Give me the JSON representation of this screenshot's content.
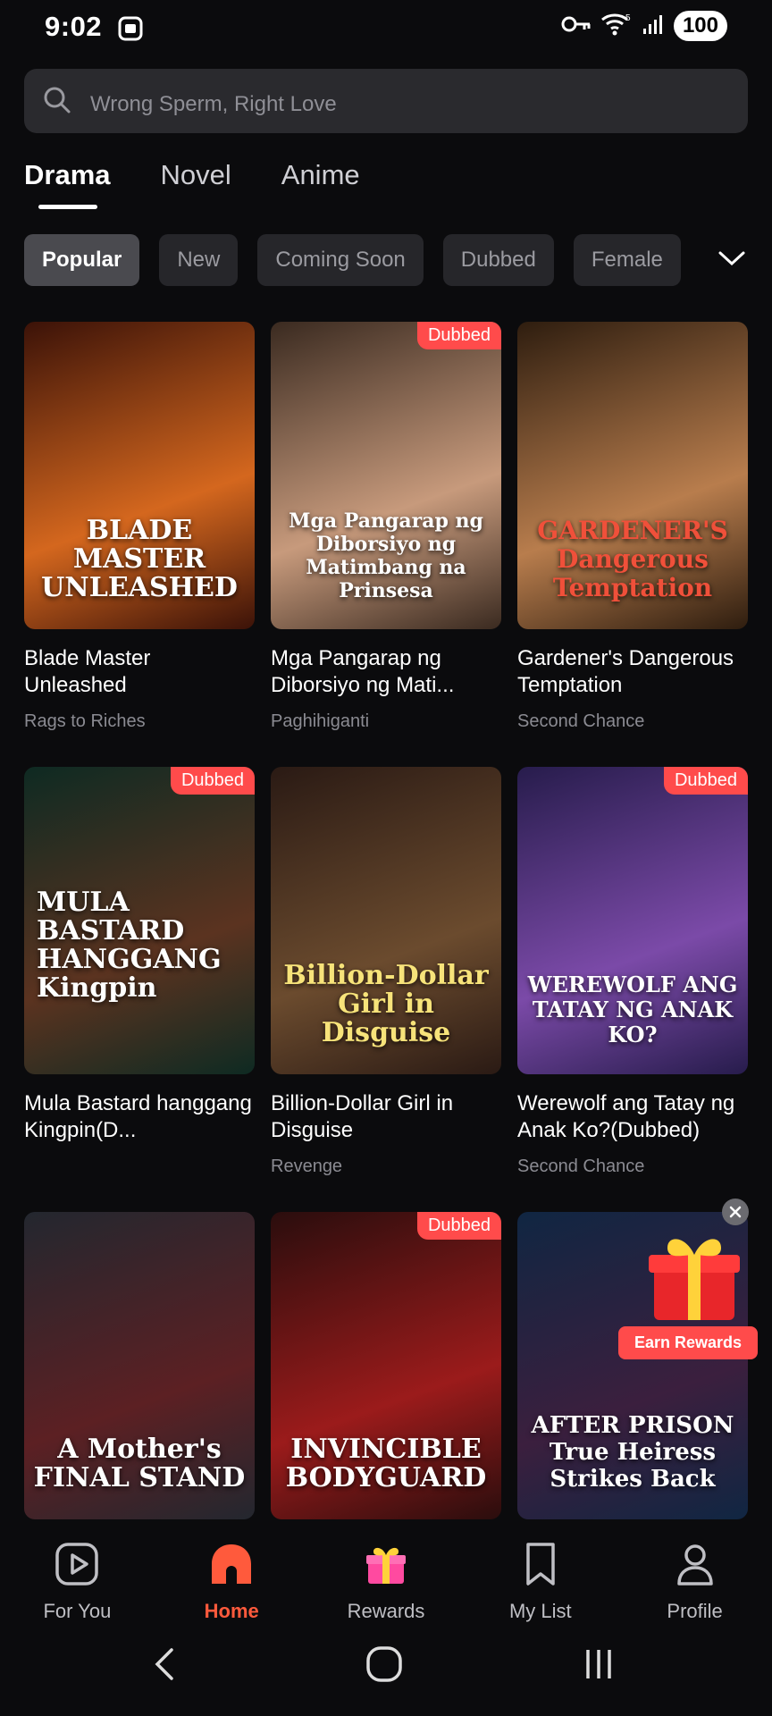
{
  "status": {
    "time": "9:02",
    "battery": "100",
    "signal": "5"
  },
  "search": {
    "placeholder": "Wrong Sperm, Right Love"
  },
  "tabs": [
    {
      "label": "Drama",
      "active": true
    },
    {
      "label": "Novel",
      "active": false
    },
    {
      "label": "Anime",
      "active": false
    }
  ],
  "filters": [
    {
      "label": "Popular",
      "active": true
    },
    {
      "label": "New"
    },
    {
      "label": "Coming Soon"
    },
    {
      "label": "Dubbed"
    },
    {
      "label": "Female"
    }
  ],
  "cards": [
    {
      "title": "Blade Master Unleashed",
      "genre": "Rags to Riches",
      "badge": "",
      "poster_text": "BLADE MASTER UNLEASHED",
      "colors": [
        "#3b1208",
        "#d4671e"
      ]
    },
    {
      "title": "Mga Pangarap ng Diborsiyo ng Mati...",
      "genre": "Paghihiganti",
      "badge": "Dubbed",
      "poster_text": "Mga Pangarap ng Diborsiyo ng Matimbang na Prinsesa",
      "colors": [
        "#3a2a20",
        "#c79a7c"
      ]
    },
    {
      "title": "Gardener's Dangerous Temptation",
      "genre": "Second Chance",
      "badge": "",
      "poster_text": "GARDENER'S Dangerous Temptation",
      "colors": [
        "#2e1d0f",
        "#b87d4d"
      ]
    },
    {
      "title": "Mula Bastard hanggang Kingpin(D...",
      "genre": "",
      "badge": "Dubbed",
      "poster_text": "MULA BASTARD HANGGANG Kingpin",
      "colors": [
        "#0e2a22",
        "#5b3320"
      ]
    },
    {
      "title": "Billion-Dollar Girl in Disguise",
      "genre": "Revenge",
      "badge": "",
      "poster_text": "Billion-Dollar Girl in Disguise",
      "colors": [
        "#2a1a14",
        "#6b4b2e"
      ]
    },
    {
      "title": "Werewolf ang Tatay ng Anak Ko?(Dubbed)",
      "genre": "Second Chance",
      "badge": "Dubbed",
      "poster_text": "WEREWOLF ANG TATAY NG ANAK KO?",
      "colors": [
        "#271c4c",
        "#7b4aa8"
      ]
    },
    {
      "title": "",
      "genre": "",
      "badge": "",
      "poster_text": "A Mother's FINAL STAND",
      "colors": [
        "#23272f",
        "#5c2023"
      ]
    },
    {
      "title": "",
      "genre": "",
      "badge": "Dubbed",
      "poster_text": "INVINCIBLE BODYGUARD",
      "colors": [
        "#2a0d0d",
        "#9b1b1b"
      ]
    },
    {
      "title": "",
      "genre": "",
      "badge": "",
      "poster_text": "AFTER PRISON True Heiress Strikes Back",
      "colors": [
        "#102642",
        "#3b1f3e"
      ]
    }
  ],
  "rewards_popup": {
    "label": "Earn Rewards"
  },
  "bottom_nav": [
    {
      "label": "For You",
      "icon": "play-icon"
    },
    {
      "label": "Home",
      "icon": "home-icon",
      "active": true
    },
    {
      "label": "Rewards",
      "icon": "gift-icon"
    },
    {
      "label": "My List",
      "icon": "bookmark-icon"
    },
    {
      "label": "Profile",
      "icon": "profile-icon"
    }
  ],
  "accent_color": "#ff5a3c",
  "badge_color": "#ff4b4b"
}
